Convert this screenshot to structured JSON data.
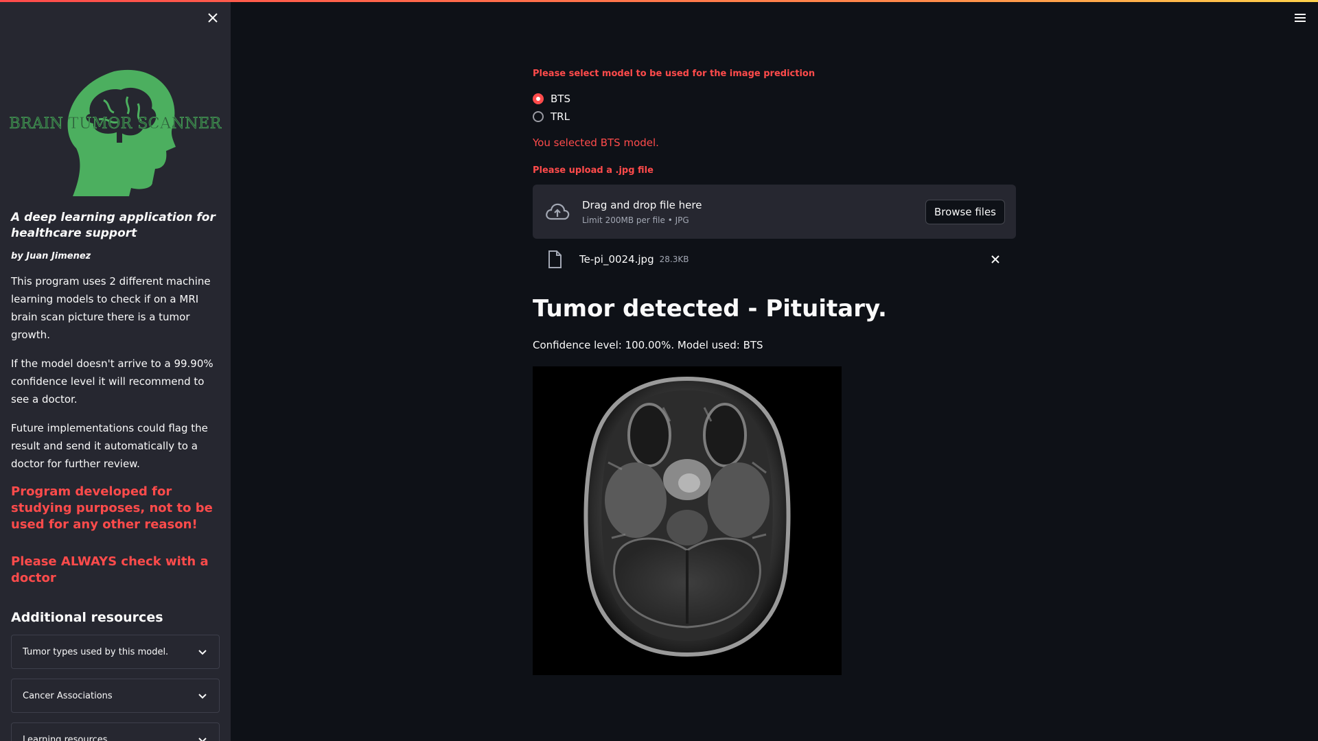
{
  "sidebar": {
    "logo_text": "BRAIN TUMOR SCANNER",
    "tagline": "A deep learning application for healthcare support",
    "byline": "by Juan Jimenez",
    "paragraphs": [
      "This program uses 2 different machine learning models to check if on a MRI brain scan picture there is a tumor growth.",
      "If the model doesn't arrive to a 99.90% confidence level it will recommend to see a doctor.",
      "Future implementations could flag the result and send it automatically to a doctor for further review."
    ],
    "warning_study": "Program developed for studying purposes, not to be used for any other reason!",
    "warning_doctor": "Please ALWAYS check with a doctor",
    "resources_title": "Additional resources",
    "expanders": [
      {
        "label": "Tumor types used by this model."
      },
      {
        "label": "Cancer Associations"
      },
      {
        "label": "Learning resources"
      }
    ]
  },
  "main": {
    "model_question": "Please select model to be used for the image prediction",
    "models": [
      {
        "label": "BTS",
        "selected": true
      },
      {
        "label": "TRL",
        "selected": false
      }
    ],
    "selected_message": "You selected BTS model.",
    "upload_label": "Please upload a .jpg file",
    "dropzone": {
      "title": "Drag and drop file here",
      "subtitle": "Limit 200MB per file • JPG",
      "browse_label": "Browse files"
    },
    "uploaded_file": {
      "name": "Te-pi_0024.jpg",
      "size": "28.3KB"
    },
    "result_title": "Tumor detected - Pituitary.",
    "confidence_text": "Confidence level: 100.00%. Model used: BTS"
  },
  "colors": {
    "accent": "#ff4b4b",
    "logo_green": "#4caf5f",
    "sidebar_bg": "#262730",
    "main_bg": "#0e1117"
  },
  "icons": {
    "sidebar_close": "close-icon",
    "menu": "hamburger-menu-icon",
    "upload": "cloud-upload-icon",
    "file": "file-icon",
    "remove": "close-icon",
    "expander": "chevron-down-icon"
  }
}
